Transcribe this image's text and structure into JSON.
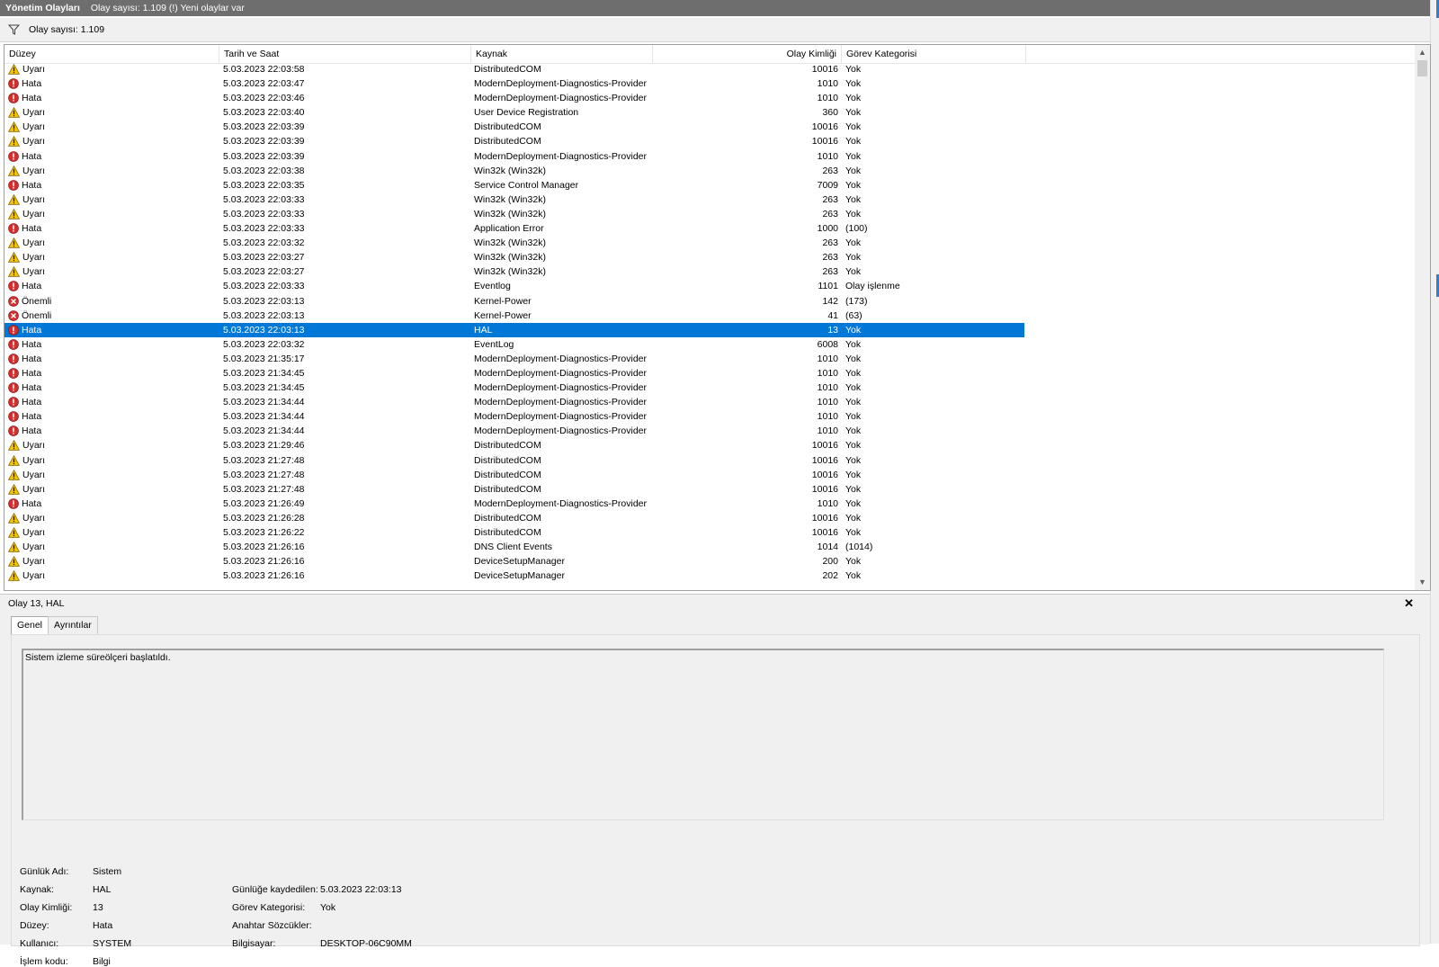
{
  "titlebar": {
    "title": "Yönetim Olayları",
    "status": "Olay sayısı: 1.109 (!) Yeni olaylar var"
  },
  "filterbar": {
    "icon": "filter-icon",
    "count_label": "Olay sayısı: 1.109"
  },
  "columns": {
    "level": "Düzey",
    "date": "Tarih ve Saat",
    "source": "Kaynak",
    "event_id": "Olay Kimliği",
    "task_category": "Görev Kategorisi"
  },
  "colors": {
    "warning": "#f5c400",
    "error": "#d32f2f",
    "critical": "#d32f2f",
    "selection": "#0078d7"
  },
  "rows": [
    {
      "level": "Uyarı",
      "type": "warning",
      "date": "5.03.2023 22:03:58",
      "source": "DistributedCOM",
      "id": "10016",
      "category": "Yok"
    },
    {
      "level": "Hata",
      "type": "error",
      "date": "5.03.2023 22:03:47",
      "source": "ModernDeployment-Diagnostics-Provider",
      "id": "1010",
      "category": "Yok"
    },
    {
      "level": "Hata",
      "type": "error",
      "date": "5.03.2023 22:03:46",
      "source": "ModernDeployment-Diagnostics-Provider",
      "id": "1010",
      "category": "Yok"
    },
    {
      "level": "Uyarı",
      "type": "warning",
      "date": "5.03.2023 22:03:40",
      "source": "User Device Registration",
      "id": "360",
      "category": "Yok"
    },
    {
      "level": "Uyarı",
      "type": "warning",
      "date": "5.03.2023 22:03:39",
      "source": "DistributedCOM",
      "id": "10016",
      "category": "Yok"
    },
    {
      "level": "Uyarı",
      "type": "warning",
      "date": "5.03.2023 22:03:39",
      "source": "DistributedCOM",
      "id": "10016",
      "category": "Yok"
    },
    {
      "level": "Hata",
      "type": "error",
      "date": "5.03.2023 22:03:39",
      "source": "ModernDeployment-Diagnostics-Provider",
      "id": "1010",
      "category": "Yok"
    },
    {
      "level": "Uyarı",
      "type": "warning",
      "date": "5.03.2023 22:03:38",
      "source": "Win32k (Win32k)",
      "id": "263",
      "category": "Yok"
    },
    {
      "level": "Hata",
      "type": "error",
      "date": "5.03.2023 22:03:35",
      "source": "Service Control Manager",
      "id": "7009",
      "category": "Yok"
    },
    {
      "level": "Uyarı",
      "type": "warning",
      "date": "5.03.2023 22:03:33",
      "source": "Win32k (Win32k)",
      "id": "263",
      "category": "Yok"
    },
    {
      "level": "Uyarı",
      "type": "warning",
      "date": "5.03.2023 22:03:33",
      "source": "Win32k (Win32k)",
      "id": "263",
      "category": "Yok"
    },
    {
      "level": "Hata",
      "type": "error",
      "date": "5.03.2023 22:03:33",
      "source": "Application Error",
      "id": "1000",
      "category": "(100)"
    },
    {
      "level": "Uyarı",
      "type": "warning",
      "date": "5.03.2023 22:03:32",
      "source": "Win32k (Win32k)",
      "id": "263",
      "category": "Yok"
    },
    {
      "level": "Uyarı",
      "type": "warning",
      "date": "5.03.2023 22:03:27",
      "source": "Win32k (Win32k)",
      "id": "263",
      "category": "Yok"
    },
    {
      "level": "Uyarı",
      "type": "warning",
      "date": "5.03.2023 22:03:27",
      "source": "Win32k (Win32k)",
      "id": "263",
      "category": "Yok"
    },
    {
      "level": "Hata",
      "type": "error",
      "date": "5.03.2023 22:03:33",
      "source": "Eventlog",
      "id": "1101",
      "category": "Olay işlenme"
    },
    {
      "level": "Önemli",
      "type": "critical",
      "date": "5.03.2023 22:03:13",
      "source": "Kernel-Power",
      "id": "142",
      "category": "(173)"
    },
    {
      "level": "Önemli",
      "type": "critical",
      "date": "5.03.2023 22:03:13",
      "source": "Kernel-Power",
      "id": "41",
      "category": "(63)"
    },
    {
      "level": "Hata",
      "type": "error",
      "date": "5.03.2023 22:03:13",
      "source": "HAL",
      "id": "13",
      "category": "Yok",
      "selected": true
    },
    {
      "level": "Hata",
      "type": "error",
      "date": "5.03.2023 22:03:32",
      "source": "EventLog",
      "id": "6008",
      "category": "Yok"
    },
    {
      "level": "Hata",
      "type": "error",
      "date": "5.03.2023 21:35:17",
      "source": "ModernDeployment-Diagnostics-Provider",
      "id": "1010",
      "category": "Yok"
    },
    {
      "level": "Hata",
      "type": "error",
      "date": "5.03.2023 21:34:45",
      "source": "ModernDeployment-Diagnostics-Provider",
      "id": "1010",
      "category": "Yok"
    },
    {
      "level": "Hata",
      "type": "error",
      "date": "5.03.2023 21:34:45",
      "source": "ModernDeployment-Diagnostics-Provider",
      "id": "1010",
      "category": "Yok"
    },
    {
      "level": "Hata",
      "type": "error",
      "date": "5.03.2023 21:34:44",
      "source": "ModernDeployment-Diagnostics-Provider",
      "id": "1010",
      "category": "Yok"
    },
    {
      "level": "Hata",
      "type": "error",
      "date": "5.03.2023 21:34:44",
      "source": "ModernDeployment-Diagnostics-Provider",
      "id": "1010",
      "category": "Yok"
    },
    {
      "level": "Hata",
      "type": "error",
      "date": "5.03.2023 21:34:44",
      "source": "ModernDeployment-Diagnostics-Provider",
      "id": "1010",
      "category": "Yok"
    },
    {
      "level": "Uyarı",
      "type": "warning",
      "date": "5.03.2023 21:29:46",
      "source": "DistributedCOM",
      "id": "10016",
      "category": "Yok"
    },
    {
      "level": "Uyarı",
      "type": "warning",
      "date": "5.03.2023 21:27:48",
      "source": "DistributedCOM",
      "id": "10016",
      "category": "Yok"
    },
    {
      "level": "Uyarı",
      "type": "warning",
      "date": "5.03.2023 21:27:48",
      "source": "DistributedCOM",
      "id": "10016",
      "category": "Yok"
    },
    {
      "level": "Uyarı",
      "type": "warning",
      "date": "5.03.2023 21:27:48",
      "source": "DistributedCOM",
      "id": "10016",
      "category": "Yok"
    },
    {
      "level": "Hata",
      "type": "error",
      "date": "5.03.2023 21:26:49",
      "source": "ModernDeployment-Diagnostics-Provider",
      "id": "1010",
      "category": "Yok"
    },
    {
      "level": "Uyarı",
      "type": "warning",
      "date": "5.03.2023 21:26:28",
      "source": "DistributedCOM",
      "id": "10016",
      "category": "Yok"
    },
    {
      "level": "Uyarı",
      "type": "warning",
      "date": "5.03.2023 21:26:22",
      "source": "DistributedCOM",
      "id": "10016",
      "category": "Yok"
    },
    {
      "level": "Uyarı",
      "type": "warning",
      "date": "5.03.2023 21:26:16",
      "source": "DNS Client Events",
      "id": "1014",
      "category": "(1014)"
    },
    {
      "level": "Uyarı",
      "type": "warning",
      "date": "5.03.2023 21:26:16",
      "source": "DeviceSetupManager",
      "id": "200",
      "category": "Yok"
    },
    {
      "level": "Uyarı",
      "type": "warning",
      "date": "5.03.2023 21:26:16",
      "source": "DeviceSetupManager",
      "id": "202",
      "category": "Yok"
    }
  ],
  "detail": {
    "title": "Olay 13, HAL",
    "close_glyph": "✕",
    "tabs": [
      {
        "label": "Genel",
        "active": true
      },
      {
        "label": "Ayrıntılar",
        "active": false
      }
    ],
    "description": "Sistem izleme süreölçeri başlatıldı.",
    "props": {
      "log_name_label": "Günlük Adı:",
      "log_name": "Sistem",
      "source_label": "Kaynak:",
      "source": "HAL",
      "event_id_label": "Olay Kimliği:",
      "event_id": "13",
      "level_label": "Düzey:",
      "level": "Hata",
      "user_label": "Kullanıcı:",
      "user": "SYSTEM",
      "opcode_label": "İşlem kodu:",
      "opcode": "Bilgi",
      "logged_label": "Günlüğe kaydedilen:",
      "logged": "5.03.2023 22:03:13",
      "task_category_label": "Görev Kategorisi:",
      "task_category": "Yok",
      "keywords_label": "Anahtar Sözcükler:",
      "keywords": "",
      "computer_label": "Bilgisayar:",
      "computer": "DESKTOP-06C90MM"
    }
  }
}
